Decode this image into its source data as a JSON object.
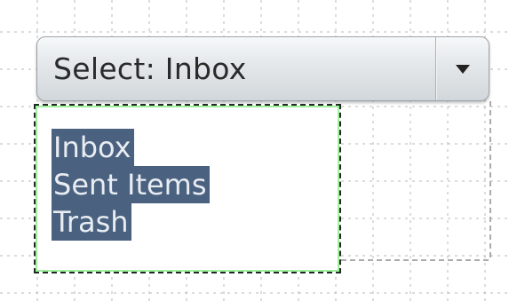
{
  "select": {
    "label": "Select: Inbox",
    "arrow_icon": "triangle-down-icon"
  },
  "dropdown": {
    "items": [
      {
        "label": "Inbox"
      },
      {
        "label": "Sent Items"
      },
      {
        "label": "Trash"
      }
    ]
  },
  "colors": {
    "selection_highlight": "#4a6180",
    "selection_text": "#e8edf2",
    "focus_outline": "#9ef09e"
  }
}
